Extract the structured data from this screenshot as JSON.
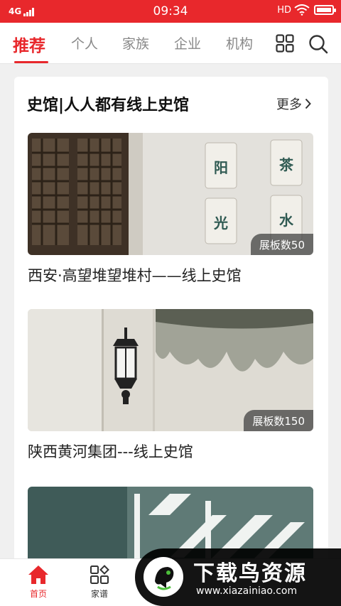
{
  "status_bar": {
    "network": "4G",
    "time": "09:34",
    "hd": "HD"
  },
  "tabs": [
    {
      "label": "推荐",
      "active": true
    },
    {
      "label": "个人"
    },
    {
      "label": "家族"
    },
    {
      "label": "企业"
    },
    {
      "label": "机构"
    }
  ],
  "icons": {
    "apps": "grid-icon",
    "search": "search-icon"
  },
  "section": {
    "title": "史馆|人人都有线上史馆",
    "more_label": "更多"
  },
  "items": [
    {
      "title": "西安·高望堆望堆村——线上史馆",
      "badge": "展板数50",
      "image": "wooden-lattice-window-and-wall-tiles"
    },
    {
      "title": "陕西黄河集团---线上史馆",
      "badge": "展板数150",
      "image": "wall-lantern-weathered-wall"
    },
    {
      "title": "",
      "badge": "",
      "image": "lattice-shadow-on-wall"
    }
  ],
  "tile_chars": [
    "阳",
    "茶",
    "光",
    "水"
  ],
  "bottom_nav": [
    {
      "label": "首页",
      "icon": "home-icon",
      "active": true
    },
    {
      "label": "家谱",
      "icon": "family-tree-icon"
    }
  ],
  "watermark": {
    "text": "下载鸟资源",
    "url": "www.xiazainiao.com"
  },
  "colors": {
    "accent": "#e8282c",
    "background": "#f0f0f0"
  }
}
